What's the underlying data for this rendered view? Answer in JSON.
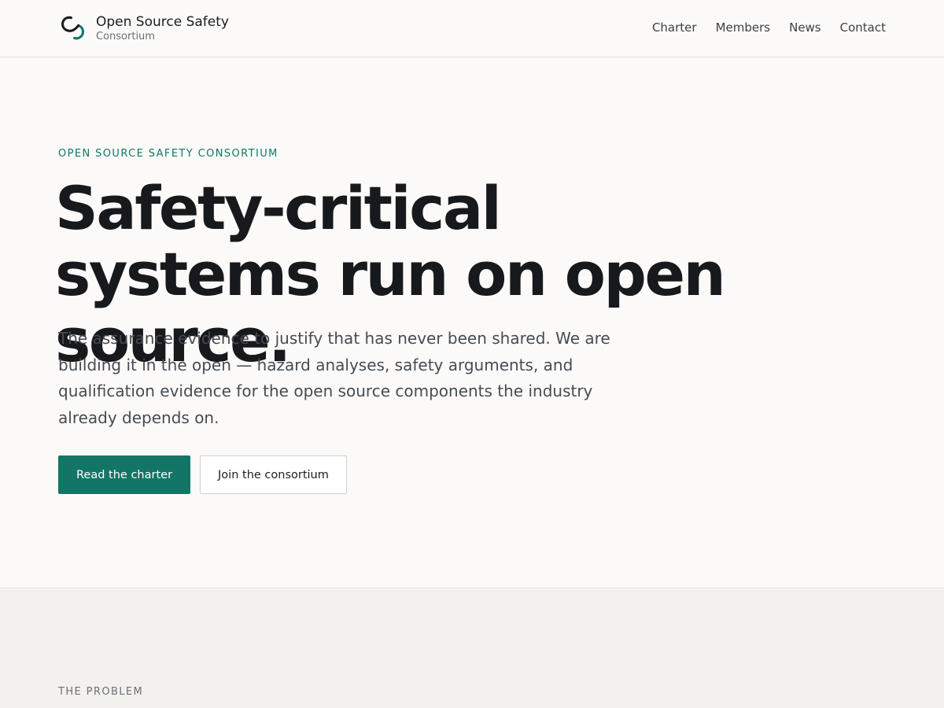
{
  "colors": {
    "accent": "#137566",
    "background": "#fbfaf8",
    "section_background": "#f3f1ee",
    "text": "#17191c",
    "muted": "#6c7075"
  },
  "header": {
    "logo_icon": "linked-rings-logo-icon",
    "brand_name": "Open Source Safety",
    "brand_sub": "Consortium",
    "nav": [
      "Charter",
      "Members",
      "News",
      "Contact"
    ]
  },
  "hero": {
    "eyebrow": "OPEN SOURCE SAFETY CONSORTIUM",
    "headline": "Safety-critical systems run on open source.",
    "lede": "The assurance evidence to justify that has never been shared. We are building it in the open — hazard analyses, safety arguments, and qualification evidence for the open source components the industry already depends on.",
    "primary_button": "Read the charter",
    "secondary_button": "Join the consortium"
  },
  "problem": {
    "label": "THE PROBLEM"
  }
}
